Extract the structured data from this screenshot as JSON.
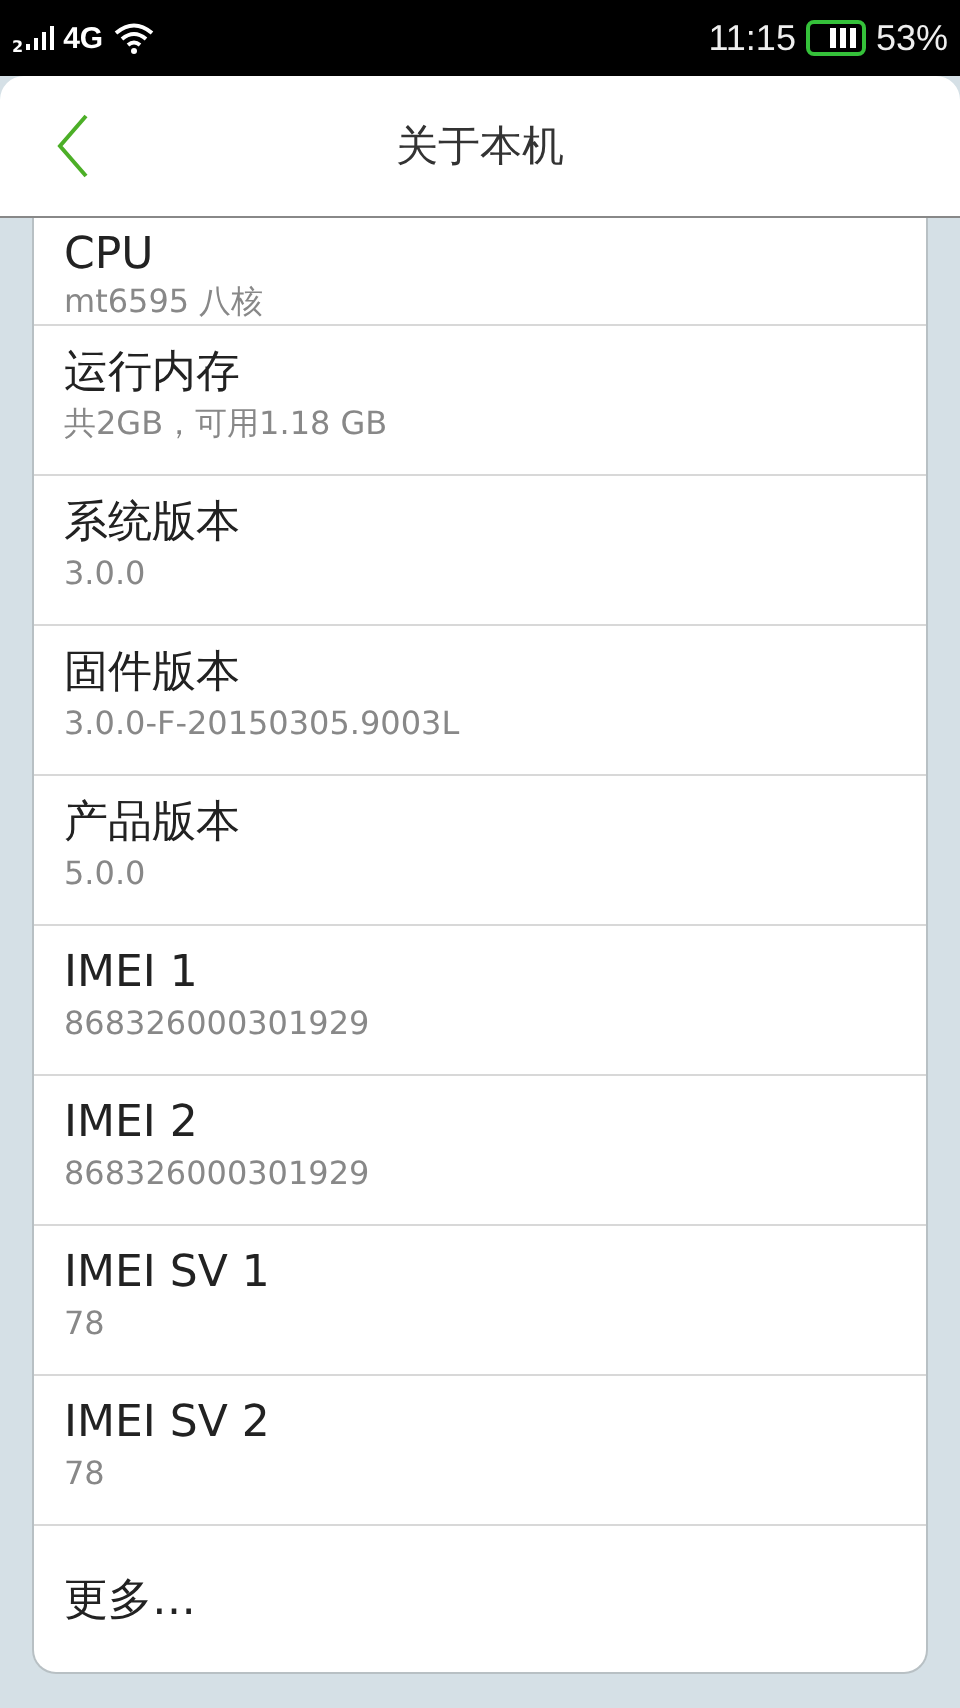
{
  "status_bar": {
    "sim": "2",
    "network": "4G",
    "time": "11:15",
    "battery": "53%"
  },
  "header": {
    "title": "关于本机"
  },
  "items": [
    {
      "title": "CPU",
      "value": "mt6595 八核"
    },
    {
      "title": "运行内存",
      "value": "共2GB，可用1.18 GB"
    },
    {
      "title": "系统版本",
      "value": "3.0.0"
    },
    {
      "title": "固件版本",
      "value": "3.0.0-F-20150305.9003L"
    },
    {
      "title": "产品版本",
      "value": "5.0.0"
    },
    {
      "title": "IMEI 1",
      "value": "868326000301929"
    },
    {
      "title": "IMEI 2",
      "value": "868326000301929"
    },
    {
      "title": "IMEI SV 1",
      "value": "78"
    },
    {
      "title": "IMEI SV 2",
      "value": "78"
    }
  ],
  "more": "更多…"
}
